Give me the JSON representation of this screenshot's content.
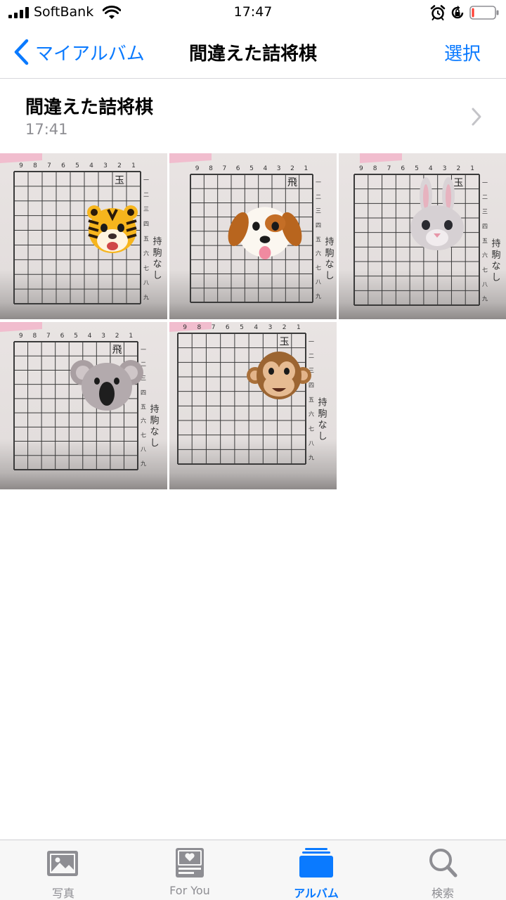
{
  "status_bar": {
    "carrier": "SoftBank",
    "time": "17:47",
    "battery_level": 0.1,
    "battery_color": "#ff3b30"
  },
  "nav": {
    "back_label": "マイアルバム",
    "title": "間違えた詰将棋",
    "select_label": "選択"
  },
  "album": {
    "title": "間違えた詰将棋",
    "time": "17:41"
  },
  "photos": [
    {
      "animal": "tiger-face",
      "piece": "玉",
      "side": "一 二 三 四 五 六 七 八 九",
      "hand": "持駒 なし"
    },
    {
      "animal": "dog-face",
      "piece": "飛",
      "side": "一 二 三 四 五 六 七 八 九",
      "hand": "持駒 なし"
    },
    {
      "animal": "rabbit-face",
      "piece": "玉",
      "side": "一 二 三 四 五 六 七 八 九",
      "hand": "持駒 なし"
    },
    {
      "animal": "koala-face",
      "piece": "飛",
      "side": "一 二 三 四 五 六 七 八 九",
      "hand": "持駒 なし"
    },
    {
      "animal": "monkey-face",
      "piece": "玉",
      "side": "一 二 三 四 五 六 七 八 九",
      "hand": "持駒 なし"
    }
  ],
  "tabs": [
    {
      "label": "写真",
      "icon": "photos-icon",
      "active": false
    },
    {
      "label": "For You",
      "icon": "for-you-icon",
      "active": false
    },
    {
      "label": "アルバム",
      "icon": "albums-icon",
      "active": true
    },
    {
      "label": "検索",
      "icon": "search-icon",
      "active": false
    }
  ],
  "colors": {
    "accent": "#0a7aff",
    "secondary_text": "#8e8e93"
  }
}
